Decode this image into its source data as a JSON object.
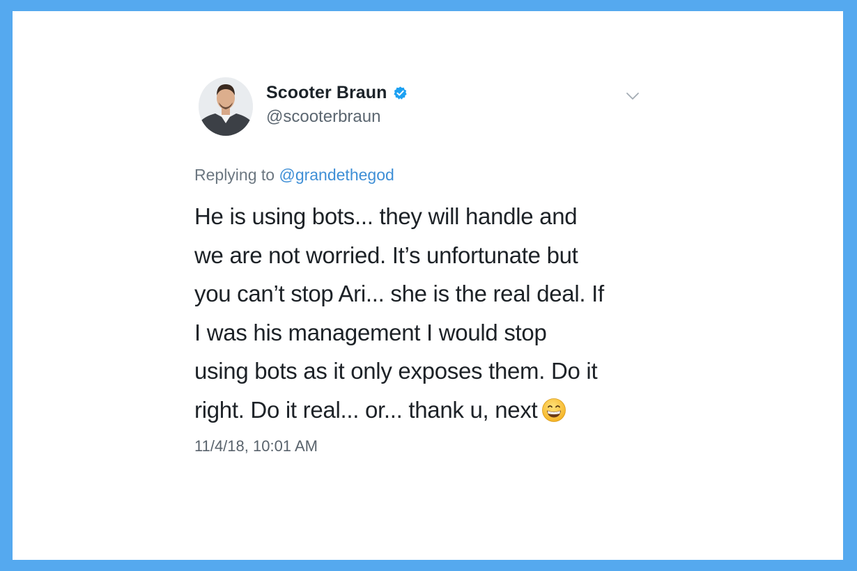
{
  "colors": {
    "frame": "#55a9ef",
    "card": "#ffffff",
    "text": "#1d2227",
    "secondary_text": "#5b6670",
    "link": "#3f8fd6",
    "verified": "#1da1f2"
  },
  "author": {
    "display_name": "Scooter Braun",
    "handle": "@scooterbraun",
    "verified": true,
    "avatar_icon": "profile-photo"
  },
  "menu": {
    "icon": "chevron-down-icon"
  },
  "reply": {
    "prefix": "Replying to",
    "to_handle": "@grandethegod"
  },
  "tweet": {
    "lines": [
      "He is using bots... they will handle and",
      "we are not worried. It’s unfortunate but",
      "you can’t stop Ari... she is the real deal. If",
      "I was his management I would stop",
      "using bots as it only exposes them. Do it",
      "right. Do it real... or... thank u, next"
    ],
    "trailing_emoji": "grinning-face-with-smiling-eyes-emoji",
    "timestamp": "11/4/18, 10:01 AM"
  }
}
